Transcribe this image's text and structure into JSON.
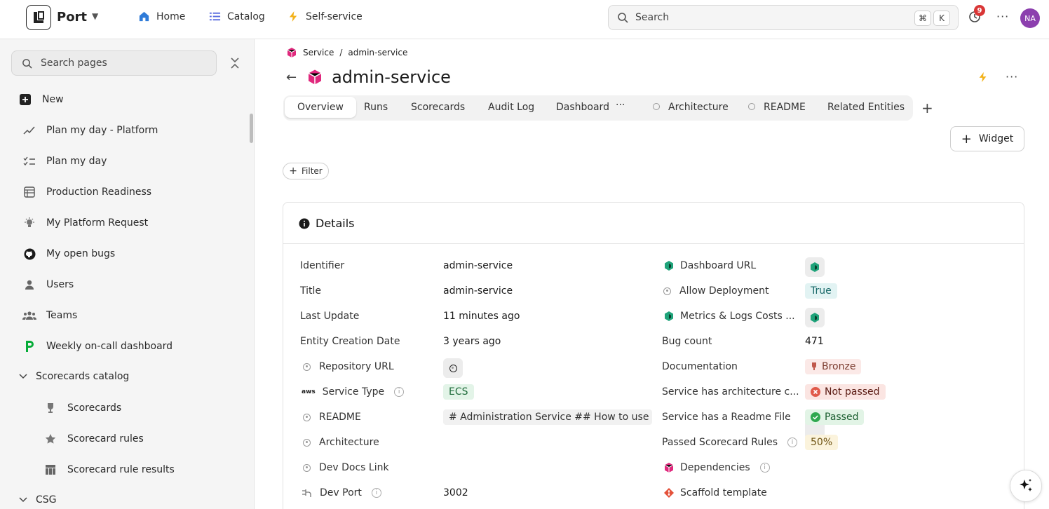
{
  "topbar": {
    "brand": "Port",
    "nav": [
      {
        "label": "Home",
        "icon": "home-icon"
      },
      {
        "label": "Catalog",
        "icon": "catalog-icon"
      },
      {
        "label": "Self-service",
        "icon": "bolt-icon"
      }
    ],
    "search_placeholder": "Search",
    "shortcut_keys": [
      "⌘",
      "K"
    ],
    "notification_count": "9",
    "avatar_initials": "NA"
  },
  "sidebar": {
    "search_placeholder": "Search pages",
    "items": [
      {
        "label": "New",
        "icon": "plus-square-icon"
      },
      {
        "label": "Plan my day - Platform",
        "icon": "trend-line-icon"
      },
      {
        "label": "Plan my day",
        "icon": "checklist-icon"
      },
      {
        "label": "Production Readiness",
        "icon": "table-icon"
      },
      {
        "label": "My Platform Request",
        "icon": "bulb-icon"
      },
      {
        "label": "My open bugs",
        "icon": "github-icon"
      },
      {
        "label": "Users",
        "icon": "user-icon"
      },
      {
        "label": "Teams",
        "icon": "team-icon"
      },
      {
        "label": "Weekly on-call dashboard",
        "icon": "pagerduty-icon"
      },
      {
        "label": "Scorecards catalog",
        "icon": "chevron-down-icon"
      },
      {
        "label": "Scorecards",
        "icon": "trophy-icon"
      },
      {
        "label": "Scorecard rules",
        "icon": "star-icon"
      },
      {
        "label": "Scorecard rule results",
        "icon": "grid-icon"
      },
      {
        "label": "CSG",
        "icon": "chevron-down-icon"
      }
    ]
  },
  "page": {
    "breadcrumb": {
      "root": "Service",
      "sep": "/",
      "current": "admin-service"
    },
    "title": "admin-service",
    "tabs": [
      "Overview",
      "Runs",
      "Scorecards",
      "Audit Log",
      "Dashboard",
      "Architecture",
      "README",
      "Related Entities"
    ],
    "tab_more": "···",
    "widget_label": "Widget",
    "filter_label": "Filter"
  },
  "details": {
    "title": "Details",
    "left": [
      {
        "label": "Identifier",
        "value": "admin-service"
      },
      {
        "label": "Title",
        "value": "admin-service"
      },
      {
        "label": "Last Update",
        "value": "11 minutes ago"
      },
      {
        "label": "Entity Creation Date",
        "value": "3 years ago"
      },
      {
        "label": "Repository URL",
        "value": ""
      },
      {
        "label": "Service Type",
        "value": "ECS"
      },
      {
        "label": "README",
        "value": "# Administration Service ## How to use ..."
      },
      {
        "label": "Architecture",
        "value": ""
      },
      {
        "label": "Dev Docs Link",
        "value": ""
      },
      {
        "label": "Dev Port",
        "value": "3002"
      }
    ],
    "right": [
      {
        "label": "Dashboard URL",
        "value": ""
      },
      {
        "label": "Allow Deployment",
        "value": "True"
      },
      {
        "label": "Metrics & Logs Costs ...",
        "value": ""
      },
      {
        "label": "Bug count",
        "value": "471"
      },
      {
        "label": "Documentation",
        "value": "Bronze"
      },
      {
        "label": "Service has architecture c...",
        "value": "Not passed"
      },
      {
        "label": "Service has a Readme File",
        "value": "Passed"
      },
      {
        "label": "Passed Scorecard Rules",
        "value": "50%"
      },
      {
        "label": "Dependencies",
        "value": ""
      },
      {
        "label": "Scaffold template",
        "value": ""
      }
    ]
  },
  "colors": {
    "accent_pink": "#e0287d",
    "bolt_yellow": "#f3b21b",
    "avatar": "#8c3fae",
    "badge_red": "#d93636"
  }
}
